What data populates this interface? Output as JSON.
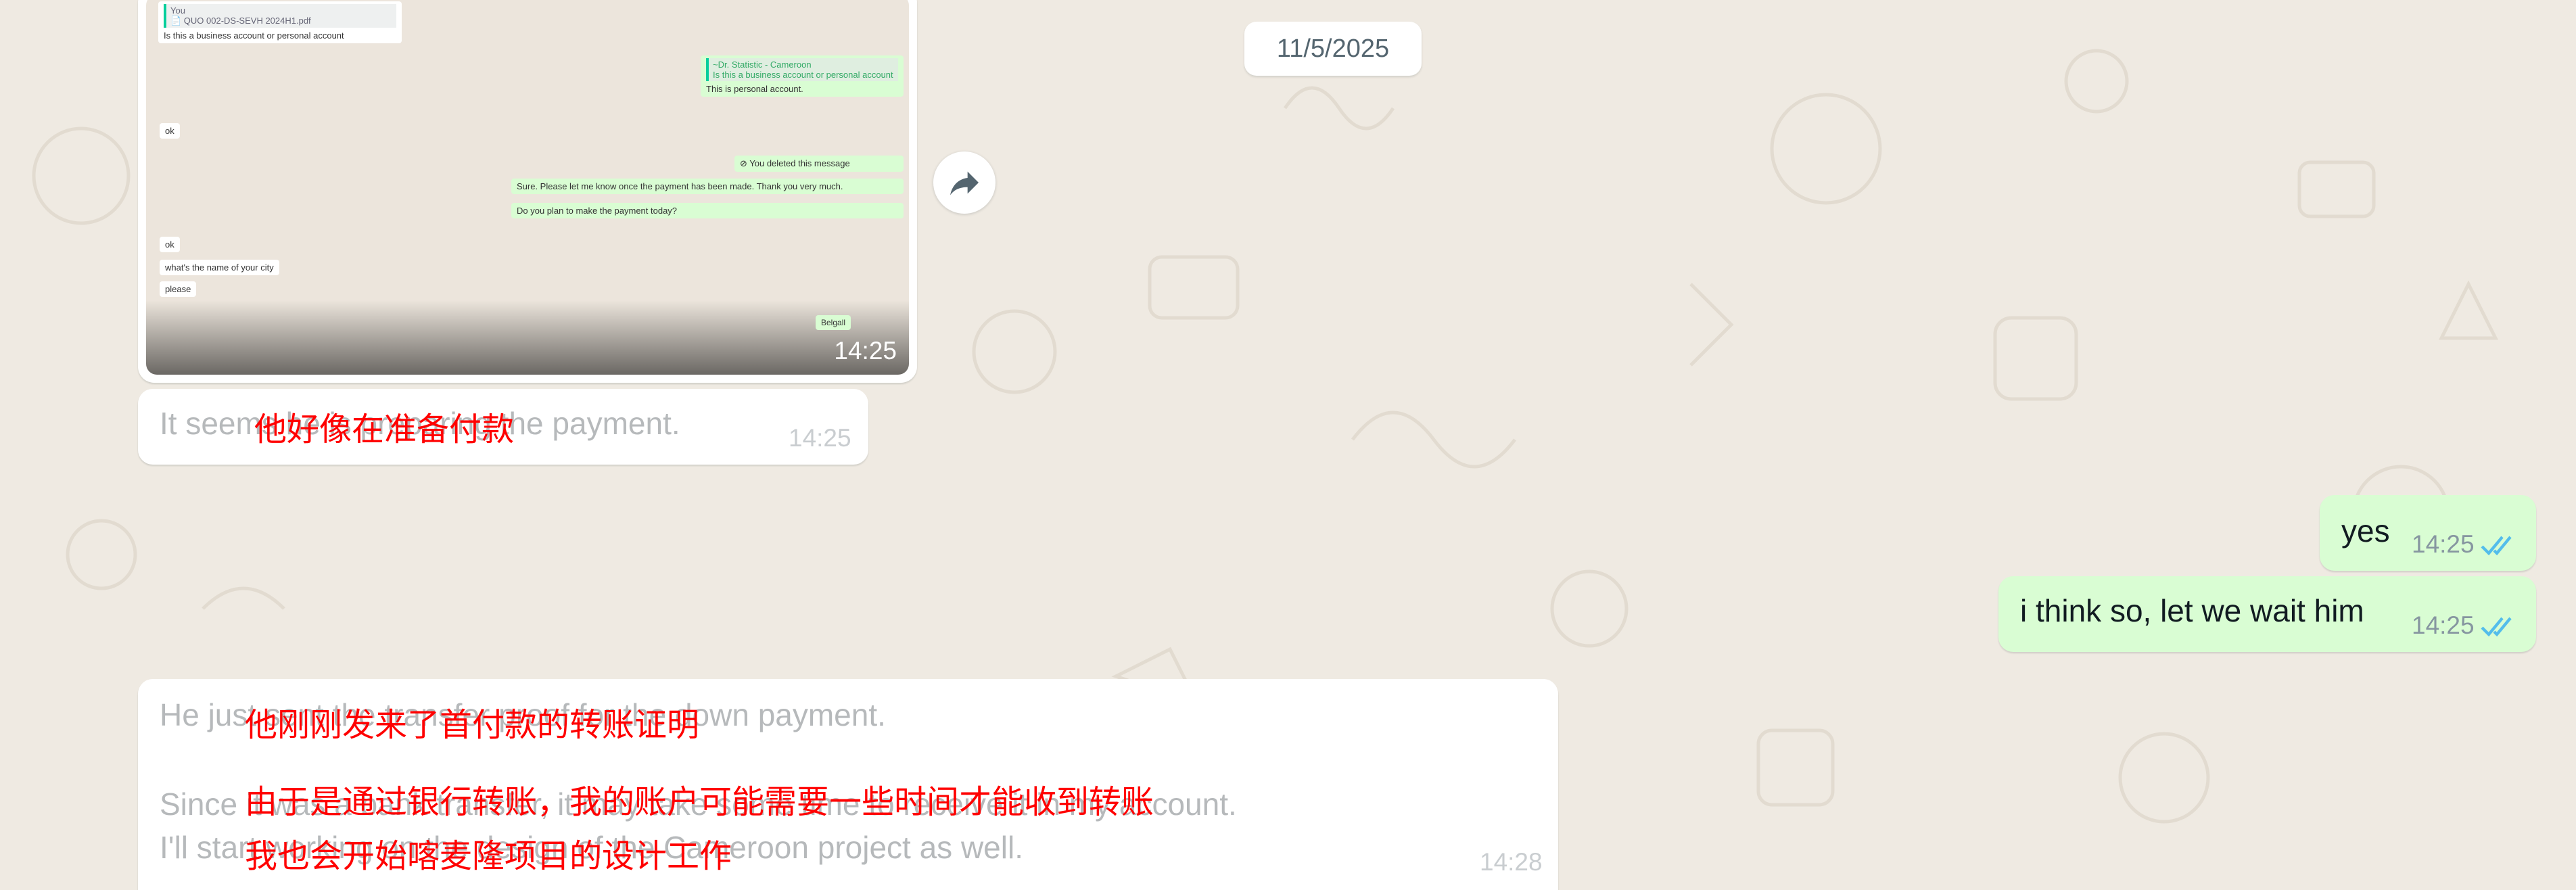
{
  "date_divider": "11/5/2025",
  "colors": {
    "background": "#efeae2",
    "incoming": "#ffffff",
    "outgoing": "#d9fdd3",
    "tick_read": "#53bdeb",
    "overlay_text": "#ff0000"
  },
  "image_message": {
    "time": "14:25",
    "preview": {
      "quoted_file": "📄 QUO 002-DS-SEVH 2024H1.pdf",
      "quoted_name": "You",
      "msg1": "Is this a business account or personal account",
      "reply_quote_name": "~Dr. Statistic - Cameroon",
      "reply_quote_text": "Is this a business account or personal account",
      "reply_text": "This is personal account.",
      "ok1": "ok",
      "deleted": "⊘ You deleted this message",
      "sure": "Sure. Please let me know once the payment has been made. Thank you very much.",
      "plan": "Do you plan to make the payment today?",
      "ok2": "ok",
      "city": "what's the name of your city",
      "please": "please",
      "badge": "Belgall"
    }
  },
  "forward_icon": "forward-icon",
  "messages": [
    {
      "direction": "in",
      "text": "It seems he is preparing the payment.",
      "time": "14:25",
      "overlay": "他好像在准备付款"
    },
    {
      "direction": "out",
      "text": "yes",
      "time": "14:25",
      "status": "read"
    },
    {
      "direction": "out",
      "text": "i think so, let we wait him",
      "time": "14:25",
      "status": "read"
    },
    {
      "direction": "in",
      "lines": [
        "He just sent the transfer proof for the down payment.",
        "Since it was a bank transfer, it may take some time to receive it in my account.",
        "I'll start working on the design of the Cameroon project as well."
      ],
      "time": "14:28",
      "overlays": [
        "他刚刚发来了首付款的转账证明",
        "由于是通过银行转账，我的账户可能需要一些时间才能收到转账",
        "我也会开始喀麦隆项目的设计工作"
      ]
    }
  ]
}
